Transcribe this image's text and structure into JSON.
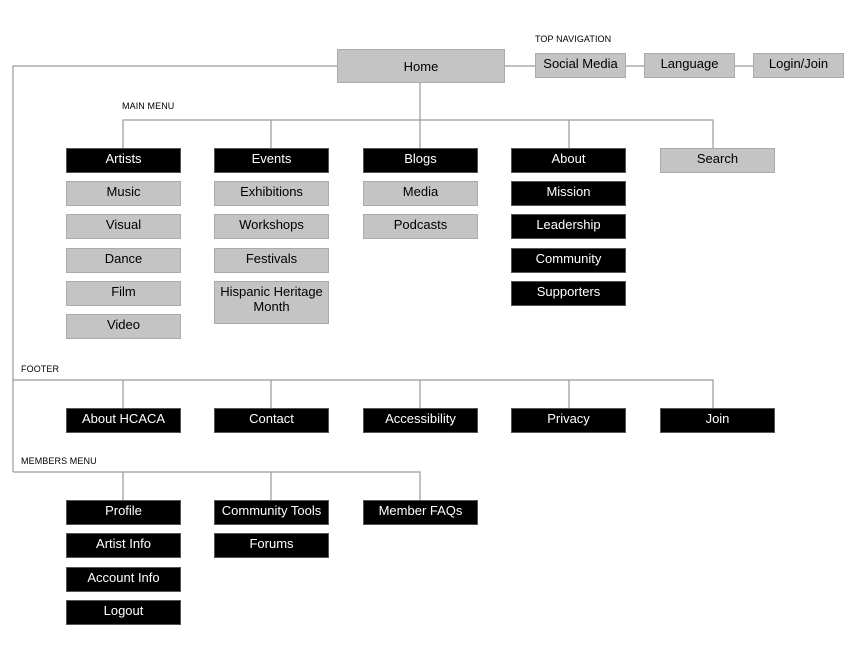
{
  "colors": {
    "dark_box": "#000000",
    "light_box": "#c4c4c4",
    "connector": "#9a9a9a"
  },
  "home": {
    "label": "Home",
    "style": "light"
  },
  "top_navigation": {
    "heading": "TOP NAVIGATION",
    "items": [
      {
        "label": "Social Media",
        "style": "light"
      },
      {
        "label": "Language",
        "style": "light"
      },
      {
        "label": "Login/Join",
        "style": "light"
      }
    ]
  },
  "main_menu": {
    "heading": "MAIN MENU",
    "columns": [
      {
        "label": "Artists",
        "style": "dark",
        "children": [
          {
            "label": "Music",
            "style": "light"
          },
          {
            "label": "Visual",
            "style": "light"
          },
          {
            "label": "Dance",
            "style": "light"
          },
          {
            "label": "Film",
            "style": "light"
          },
          {
            "label": "Video",
            "style": "light"
          }
        ]
      },
      {
        "label": "Events",
        "style": "dark",
        "children": [
          {
            "label": "Exhibitions",
            "style": "light"
          },
          {
            "label": "Workshops",
            "style": "light"
          },
          {
            "label": "Festivals",
            "style": "light"
          },
          {
            "label": "Hispanic Heritage Month",
            "style": "light"
          }
        ]
      },
      {
        "label": "Blogs",
        "style": "dark",
        "children": [
          {
            "label": "Media",
            "style": "light"
          },
          {
            "label": "Podcasts",
            "style": "light"
          }
        ]
      },
      {
        "label": "About",
        "style": "dark",
        "children": [
          {
            "label": "Mission",
            "style": "dark"
          },
          {
            "label": "Leadership",
            "style": "dark"
          },
          {
            "label": "Community",
            "style": "dark"
          },
          {
            "label": "Supporters",
            "style": "dark"
          }
        ]
      },
      {
        "label": "Search",
        "style": "light",
        "children": []
      }
    ]
  },
  "footer": {
    "heading": "FOOTER",
    "items": [
      {
        "label": "About HCACA",
        "style": "dark"
      },
      {
        "label": "Contact",
        "style": "dark"
      },
      {
        "label": "Accessibility",
        "style": "dark"
      },
      {
        "label": "Privacy",
        "style": "dark"
      },
      {
        "label": "Join",
        "style": "dark"
      }
    ]
  },
  "members_menu": {
    "heading": "MEMBERS MENU",
    "columns": [
      {
        "label": "Profile",
        "style": "dark",
        "children": [
          {
            "label": "Artist Info",
            "style": "dark"
          },
          {
            "label": "Account Info",
            "style": "dark"
          },
          {
            "label": "Logout",
            "style": "dark"
          }
        ]
      },
      {
        "label": "Community Tools",
        "style": "dark",
        "children": [
          {
            "label": "Forums",
            "style": "dark"
          }
        ]
      },
      {
        "label": "Member FAQs",
        "style": "dark",
        "children": []
      }
    ]
  }
}
